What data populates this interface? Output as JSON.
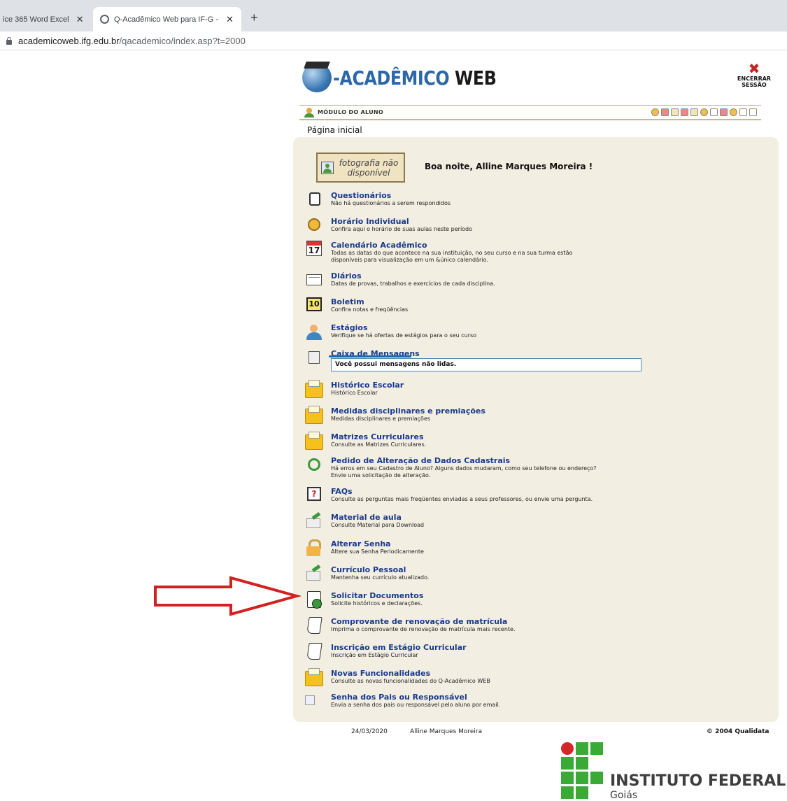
{
  "browser": {
    "tabs": [
      {
        "title": "ice 365 Word Excel",
        "close": "✕"
      },
      {
        "title": "Q-Acadêmico Web para IF-G - Be",
        "close": "✕"
      }
    ],
    "new_tab": "+",
    "url_host": "academicoweb.ifg.edu.br",
    "url_path": "/qacademico/index.asp?t=2000"
  },
  "header": {
    "logo_text_main": "-ACADÊMICO",
    "logo_text_web": "WEB",
    "logout_line1": "ENCERRAR",
    "logout_line2": "SESSÃO",
    "module_label": "MÓDULO DO ALUNO"
  },
  "page": {
    "heading": "Página inicial",
    "photo_line1": "fotografia não",
    "photo_line2": "disponível",
    "greeting": "Boa noite, Alline Marques Moreira !"
  },
  "items": [
    {
      "title": "Questionários",
      "desc": "Não há questionários a serem respondidos"
    },
    {
      "title": "Horário Individual",
      "desc": "Confira aqui o horário de suas aulas neste período"
    },
    {
      "title": "Calendário Acadêmico",
      "desc": "Todas as datas do que acontece na sua instituição, no seu curso e na sua turma estão",
      "desc2": "disponíveis para visualização em um &único calendário.",
      "icon_text": "17"
    },
    {
      "title": "Diários",
      "desc": "Datas de provas, trabalhos e exercícios de cada disciplina."
    },
    {
      "title": "Boletim",
      "desc": "Confira notas e freqüências",
      "icon_text": "10"
    },
    {
      "title": "Estágios",
      "desc": "Verifique se há ofertas de estágios para o seu curso"
    },
    {
      "title": "Caixa de Mensagens",
      "desc": "Você possui mensagens não lidas."
    },
    {
      "title": "Histórico Escolar",
      "desc": "Histórico Escolar"
    },
    {
      "title": "Medidas disciplinares e premiações",
      "desc": "Medidas disciplinares e premiações"
    },
    {
      "title": "Matrizes Curriculares",
      "desc": "Consulte as Matrizes Curriculares."
    },
    {
      "title": "Pedido de Alteração de Dados Cadastrais",
      "desc": "Há erros em seu Cadastro de Aluno? Alguns dados mudaram, como seu telefone ou endereço?",
      "desc2": "Envie uma solicitação de alteração."
    },
    {
      "title": "FAQs",
      "desc": "Consulte as perguntas mais freqüentes enviadas a seus professores, ou envie uma pergunta.",
      "icon_text": "?"
    },
    {
      "title": "Material de aula",
      "desc": "Consulte Material para Download"
    },
    {
      "title": "Alterar Senha",
      "desc": "Altere sua Senha Periodicamente"
    },
    {
      "title": "Currículo Pessoal",
      "desc": "Mantenha seu currículo atualizado."
    },
    {
      "title": "Solicitar Documentos",
      "desc": "Solicite históricos e declarações."
    },
    {
      "title": "Comprovante de renovação de matrícula",
      "desc": "Imprima o comprovante de renovação de matrícula mais recente."
    },
    {
      "title": "Inscrição em Estágio Curricular",
      "desc": "Inscrição em Estágio Curricular"
    },
    {
      "title": "Novas Funcionalidades",
      "desc": "Consulte as novas funcionalidades do Q-Acadêmico WEB"
    },
    {
      "title": "Senha dos Pais ou Responsável",
      "desc": "Envia a senha dos pais ou responsável pelo aluno por email."
    }
  ],
  "footer": {
    "date": "24/03/2020",
    "name": "Alline Marques Moreira",
    "copyright": "© 2004 Qualidata"
  },
  "institution": {
    "name": "INSTITUTO FEDERAL",
    "state": "Goiás"
  },
  "colors": {
    "panel_bg": "#f2eee2",
    "link": "#1a3a8c",
    "annotation_arrow": "#d32020",
    "if_green": "#3aa935",
    "if_red": "#d32828"
  }
}
